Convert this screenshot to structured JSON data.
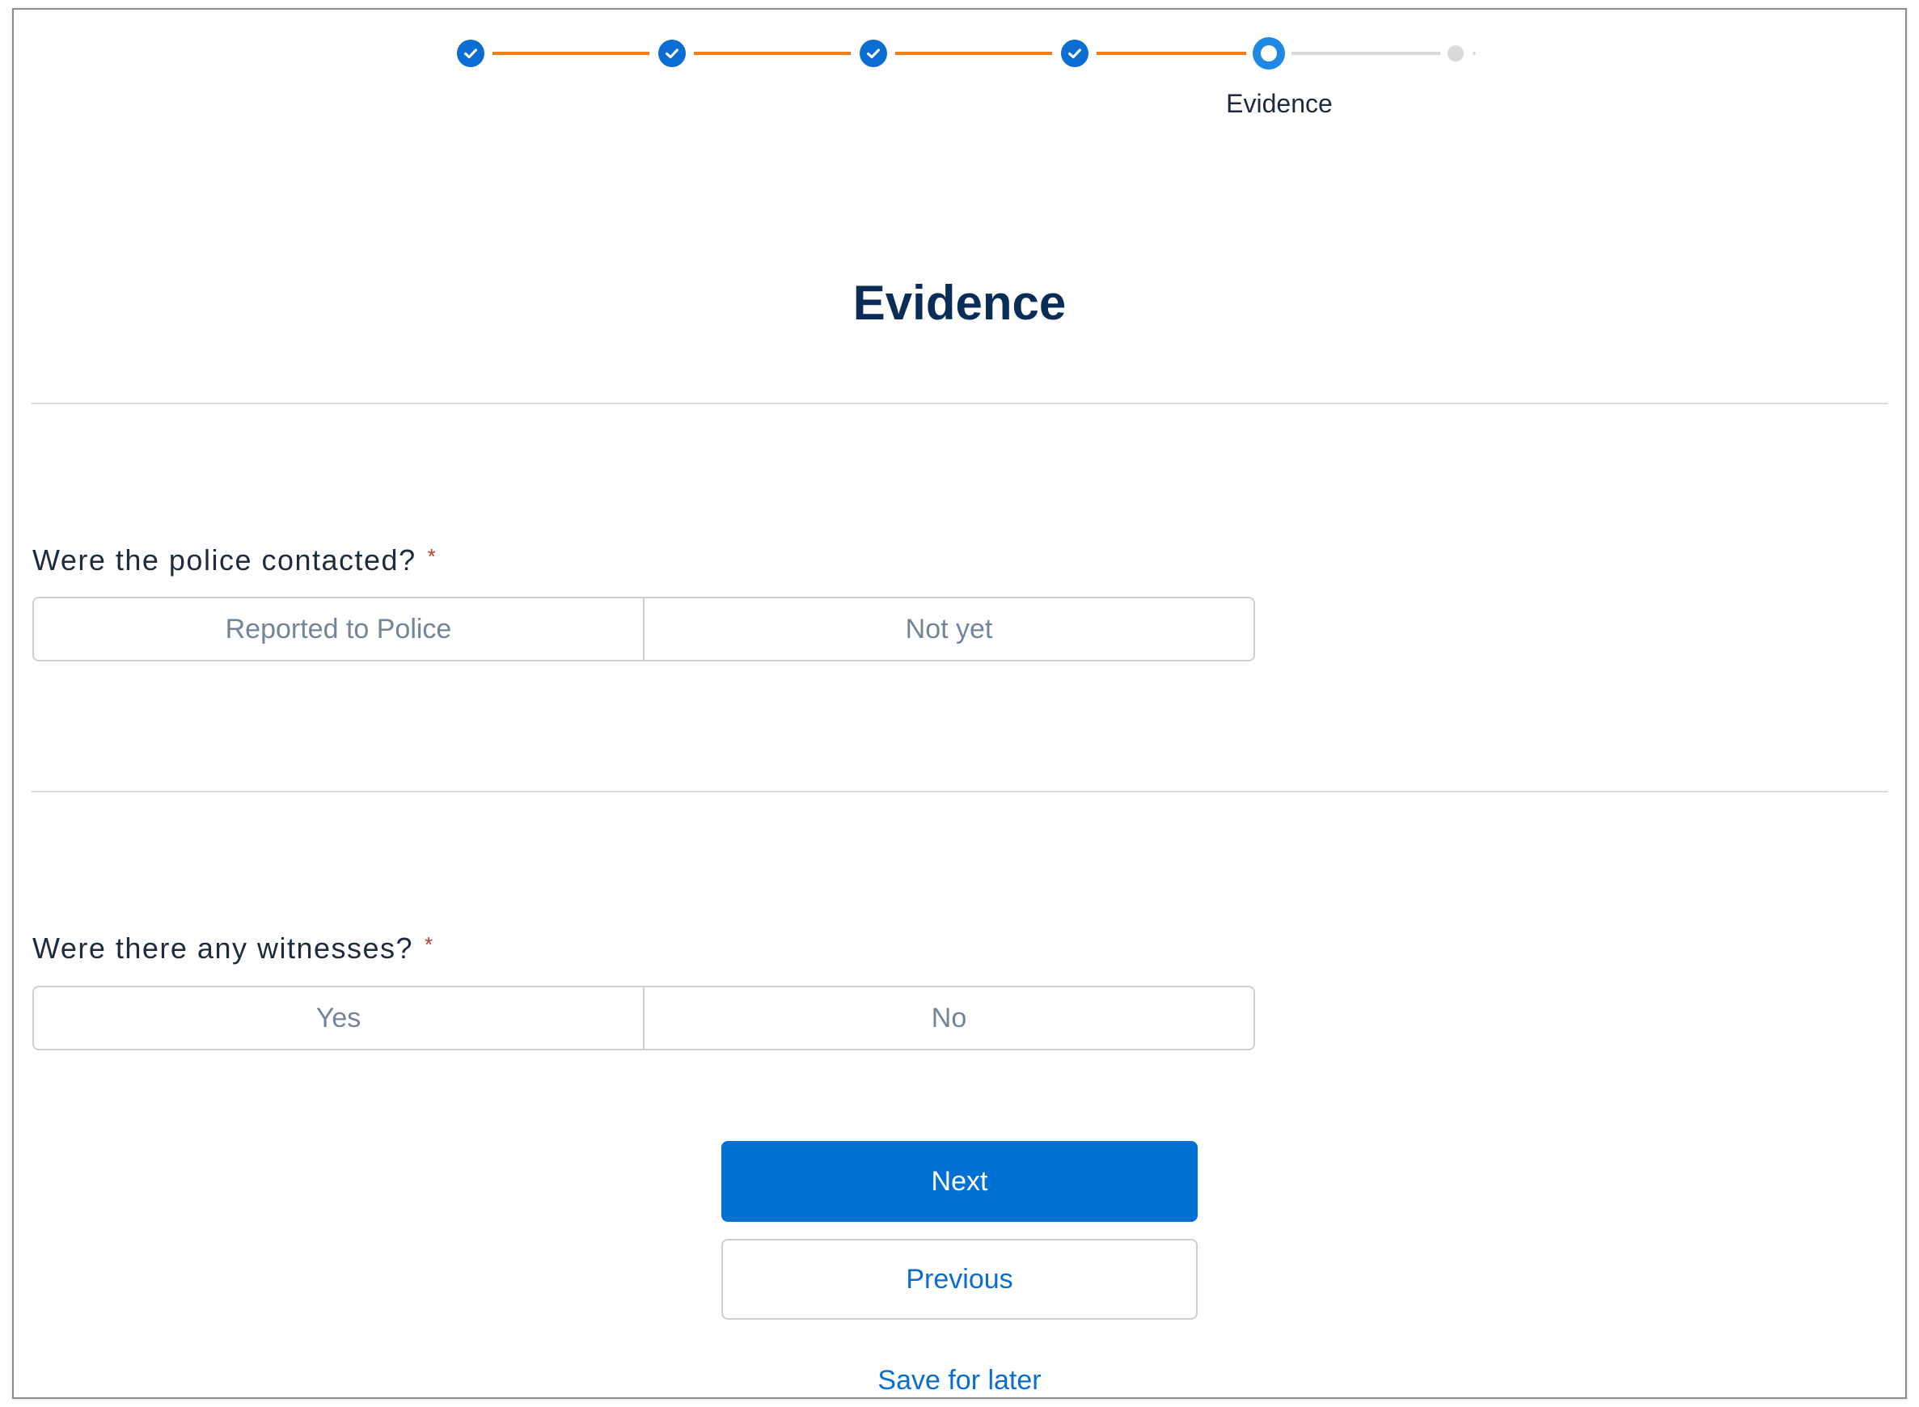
{
  "stepper": {
    "current_step_label": "Evidence",
    "colors": {
      "completed": "#0b6dd1",
      "connector_done": "#ee7d1b",
      "connector_todo": "#d9d9d9",
      "current": "#1e88e5"
    }
  },
  "page": {
    "title": "Evidence"
  },
  "questions": [
    {
      "label": "Were the police contacted?",
      "required_marker": "*",
      "options": [
        "Reported to Police",
        "Not yet"
      ]
    },
    {
      "label": "Were there any witnesses?",
      "required_marker": "*",
      "options": [
        "Yes",
        "No"
      ]
    }
  ],
  "actions": {
    "next_label": "Next",
    "previous_label": "Previous",
    "save_label": "Save for later"
  }
}
